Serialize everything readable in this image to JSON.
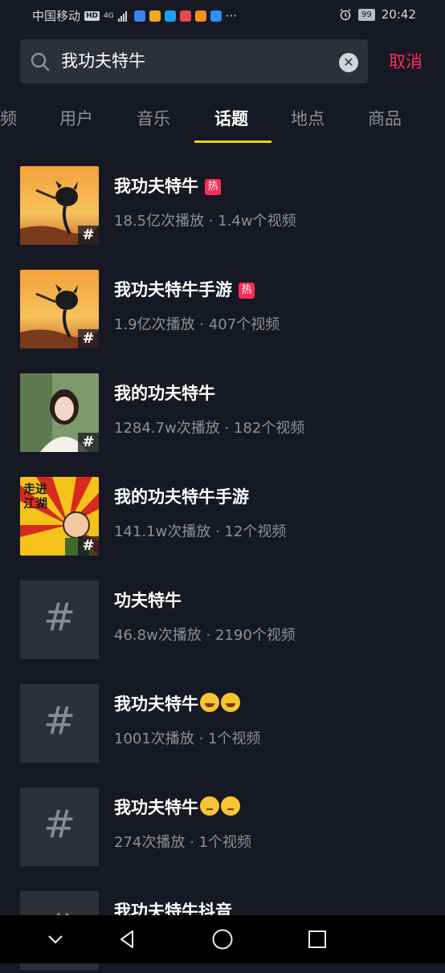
{
  "status_bar": {
    "carrier": "中国移动",
    "hd": "HD",
    "network": "4G",
    "more": "···",
    "battery": "99",
    "time": "20:42",
    "app_icon_colors": [
      "#3b82f6",
      "#f5a623",
      "#1aa1f2",
      "#e5484d",
      "#ff8a1f",
      "#2c8ef8"
    ]
  },
  "search": {
    "query": "我功夫特牛",
    "cancel_label": "取消"
  },
  "tabs": [
    {
      "label": "频"
    },
    {
      "label": "用户"
    },
    {
      "label": "音乐"
    },
    {
      "label": "话题",
      "active": true
    },
    {
      "label": "地点"
    },
    {
      "label": "商品"
    }
  ],
  "topics": [
    {
      "title": "我功夫特牛",
      "hot": true,
      "hot_label": "热",
      "stats": "18.5亿次播放 · 1.4w个视频",
      "thumb": "game"
    },
    {
      "title": "我功夫特牛手游",
      "hot": true,
      "hot_label": "热",
      "stats": "1.9亿次播放 · 407个视频",
      "thumb": "game"
    },
    {
      "title": "我的功夫特牛",
      "hot": false,
      "stats": "1284.7w次播放 · 182个视频",
      "thumb": "portrait"
    },
    {
      "title": "我的功夫特牛手游",
      "hot": false,
      "stats": "141.1w次播放 · 12个视频",
      "thumb": "poster",
      "poster_text": "走进江湖"
    },
    {
      "title": "功夫特牛",
      "hot": false,
      "stats": "46.8w次播放 · 2190个视频",
      "thumb": "hashtag"
    },
    {
      "title": "我功夫特牛",
      "emoji": "laugh",
      "stats": "1001次播放 · 1个视频",
      "thumb": "hashtag"
    },
    {
      "title": "我功夫特牛",
      "emoji": "think",
      "stats": "274次播放 · 1个视频",
      "thumb": "hashtag"
    },
    {
      "title": "我功夫特牛抖音",
      "stats": "",
      "thumb": "hashtag"
    }
  ],
  "hashtag_symbol": "#",
  "colors": {
    "background": "#161823",
    "accent_red": "#fe2c55",
    "tab_underline": "#face15",
    "muted_text": "#8f9095"
  },
  "nav_bar": {
    "icons": [
      "chevron-down-icon",
      "back-triangle-icon",
      "home-circle-icon",
      "recents-square-icon"
    ]
  }
}
